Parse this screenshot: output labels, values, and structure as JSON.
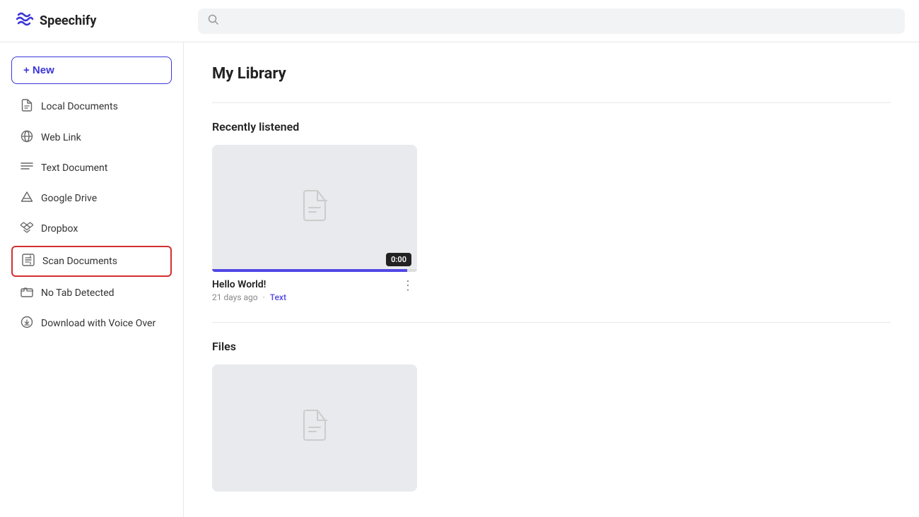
{
  "app": {
    "name": "Speechify",
    "logo_symbol": "⚡"
  },
  "search": {
    "placeholder": ""
  },
  "sidebar": {
    "new_button_label": "+ New",
    "items": [
      {
        "id": "local-documents",
        "label": "Local Documents",
        "icon": "doc"
      },
      {
        "id": "web-link",
        "label": "Web Link",
        "icon": "cloud"
      },
      {
        "id": "text-document",
        "label": "Text Document",
        "icon": "text"
      },
      {
        "id": "google-drive",
        "label": "Google Drive",
        "icon": "drive"
      },
      {
        "id": "dropbox",
        "label": "Dropbox",
        "icon": "dropbox"
      },
      {
        "id": "scan-documents",
        "label": "Scan Documents",
        "icon": "scan",
        "highlighted": true
      },
      {
        "id": "no-tab-detected",
        "label": "No Tab Detected",
        "icon": "tab"
      },
      {
        "id": "download-voice-over",
        "label": "Download with Voice Over",
        "icon": "download"
      }
    ]
  },
  "content": {
    "page_title": "My Library",
    "sections": [
      {
        "id": "recently-listened",
        "title": "Recently listened",
        "cards": [
          {
            "id": "hello-world",
            "title": "Hello World!",
            "time_badge": "0:00",
            "timestamp": "21 days ago",
            "tag": "Text",
            "progress_percent": 95
          }
        ]
      },
      {
        "id": "files",
        "title": "Files",
        "cards": [
          {
            "id": "files-card-1",
            "title": "",
            "time_badge": "",
            "timestamp": "",
            "tag": "",
            "progress_percent": 0
          }
        ]
      }
    ]
  }
}
